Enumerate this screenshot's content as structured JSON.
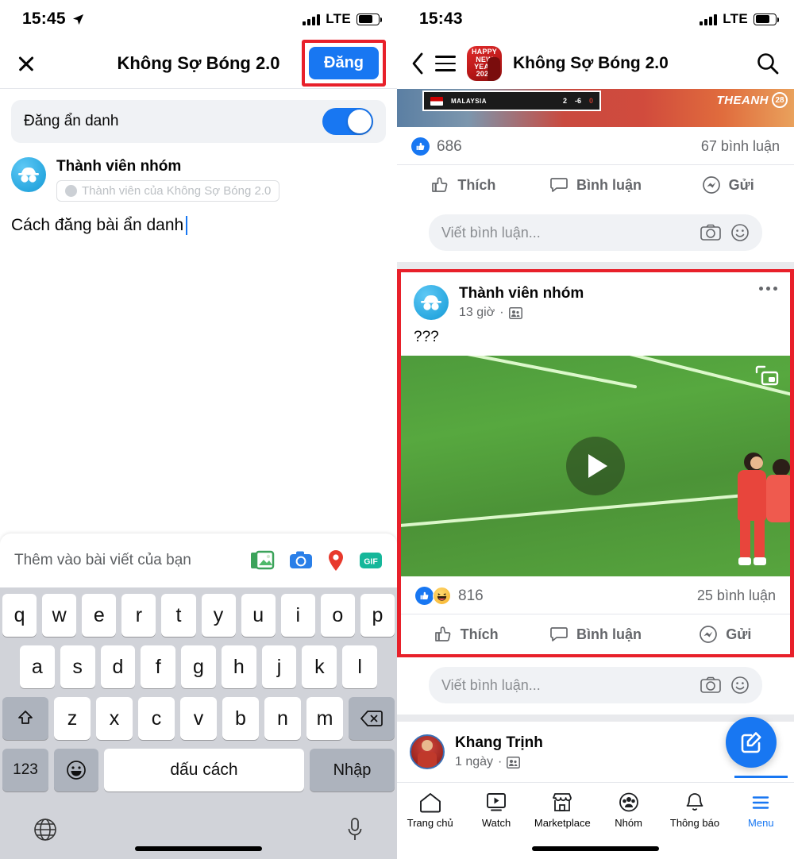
{
  "left": {
    "status": {
      "time": "15:45",
      "network": "LTE",
      "location_icon": "location-arrow-icon"
    },
    "header": {
      "close_icon": "close-icon",
      "title": "Không Sợ Bóng 2.0",
      "post_label": "Đăng"
    },
    "anonymous": {
      "label": "Đăng ẩn danh",
      "toggle_state": "on"
    },
    "author": {
      "name": "Thành viên nhóm",
      "audience_chip": "Thành viên của Không Sợ Bóng 2.0",
      "avatar_icon": "incognito-avatar-icon"
    },
    "composer": {
      "text": "Cách đăng bài ẩn danh"
    },
    "attach": {
      "label": "Thêm vào bài viết của bạn",
      "icons": [
        "photo-icon",
        "camera-icon",
        "location-pin-icon",
        "gif-icon"
      ],
      "gif_label": "GIF"
    },
    "keyboard": {
      "row1": [
        "q",
        "w",
        "e",
        "r",
        "t",
        "y",
        "u",
        "i",
        "o",
        "p"
      ],
      "row2": [
        "a",
        "s",
        "d",
        "f",
        "g",
        "h",
        "j",
        "k",
        "l"
      ],
      "row3": [
        "z",
        "x",
        "c",
        "v",
        "b",
        "n",
        "m"
      ],
      "shift_icon": "shift-icon",
      "backspace_icon": "backspace-icon",
      "numbers_label": "123",
      "emoji_icon": "emoji-icon",
      "space_label": "dấu cách",
      "enter_label": "Nhập",
      "globe_icon": "globe-icon",
      "mic_icon": "microphone-icon"
    }
  },
  "right": {
    "status": {
      "time": "15:43",
      "network": "LTE"
    },
    "header": {
      "back_icon": "back-chevron-icon",
      "menu_icon": "hamburger-icon",
      "avatar_icon": "group-avatar-icon",
      "avatar_text": "HAPPY NEW YEAR 2022",
      "title": "Không Sợ Bóng 2.0",
      "search_icon": "search-icon"
    },
    "banner": {
      "team": "MALAYSIA",
      "score": "2",
      "diff": "-6",
      "extra": "0",
      "watermark": "THEANH",
      "watermark_badge": "28"
    },
    "post1": {
      "reactions": "686",
      "comments": "67 bình luận",
      "actions": [
        "Thích",
        "Bình luận",
        "Gửi"
      ],
      "comment_placeholder": "Viết bình luận..."
    },
    "post2": {
      "author": "Thành viên nhóm",
      "time": "13 giờ",
      "privacy_icon": "group-privacy-icon",
      "more_icon": "more-options-icon",
      "text": "???",
      "video": {
        "play_icon": "play-icon",
        "pip_icon": "picture-in-picture-icon"
      },
      "reactions": "816",
      "comments": "25 bình luận",
      "actions": [
        "Thích",
        "Bình luận",
        "Gửi"
      ],
      "comment_placeholder": "Viết bình luận..."
    },
    "post3": {
      "author": "Khang Trịnh",
      "time": "1 ngày",
      "privacy_icon": "group-privacy-icon"
    },
    "fab": {
      "icon": "compose-icon"
    },
    "nav": [
      {
        "label": "Trang chủ",
        "icon": "home-icon",
        "active": false
      },
      {
        "label": "Watch",
        "icon": "watch-icon",
        "active": false
      },
      {
        "label": "Marketplace",
        "icon": "marketplace-icon",
        "active": false
      },
      {
        "label": "Nhóm",
        "icon": "groups-icon",
        "active": false
      },
      {
        "label": "Thông báo",
        "icon": "bell-icon",
        "active": false
      },
      {
        "label": "Menu",
        "icon": "menu-icon",
        "active": true
      }
    ]
  },
  "colors": {
    "brand_blue": "#1877f2",
    "highlight_red": "#e8202a",
    "grey_bg": "#f0f2f5"
  }
}
